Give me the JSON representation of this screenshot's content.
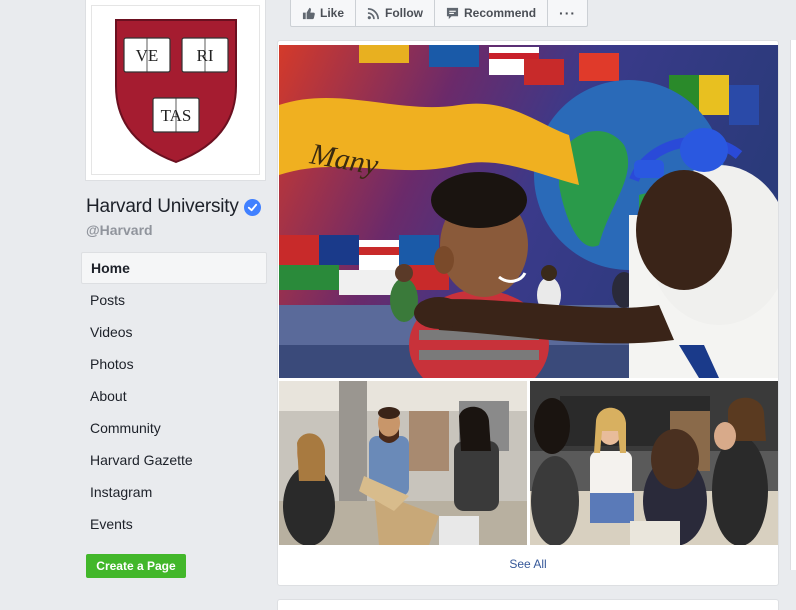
{
  "page": {
    "name": "Harvard University",
    "handle": "@Harvard",
    "shield_words": [
      "VE",
      "RI",
      "TAS"
    ]
  },
  "nav": {
    "items": [
      {
        "label": "Home",
        "active": true
      },
      {
        "label": "Posts"
      },
      {
        "label": "Videos"
      },
      {
        "label": "Photos"
      },
      {
        "label": "About"
      },
      {
        "label": "Community"
      },
      {
        "label": "Harvard Gazette"
      },
      {
        "label": "Instagram"
      },
      {
        "label": "Events"
      }
    ],
    "create_page_label": "Create a Page"
  },
  "actions": {
    "like": "Like",
    "follow": "Follow",
    "recommend": "Recommend",
    "more": "···"
  },
  "photos": {
    "see_all": "See All",
    "mural_word": "Many"
  },
  "colors": {
    "harvard_crimson": "#a51c30",
    "link": "#365899",
    "create_button": "#42b72a",
    "verified": "#4080ff"
  }
}
